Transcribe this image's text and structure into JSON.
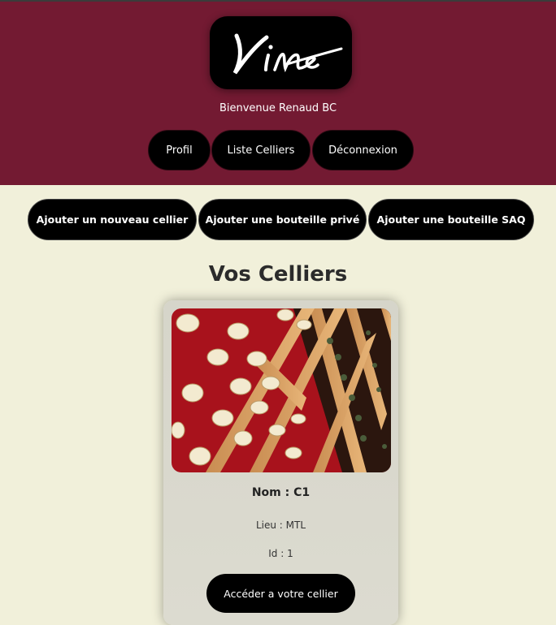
{
  "header": {
    "logo_text": "Vino",
    "welcome": "Bienvenue Renaud BC",
    "nav": [
      "Profil",
      "Liste Celliers",
      "Déconnexion"
    ]
  },
  "actions": [
    "Ajouter un nouveau cellier",
    "Ajouter une bouteille privé",
    "Ajouter une bouteille SAQ"
  ],
  "main": {
    "title": "Vos Celliers",
    "cellar": {
      "name": "Nom : C1",
      "lieu": "Lieu : MTL",
      "id": "Id : 1",
      "button": "Accéder a votre cellier"
    }
  },
  "colors": {
    "header_bg": "#731a32",
    "page_bg": "#f1f0da",
    "button_bg": "#000000"
  }
}
